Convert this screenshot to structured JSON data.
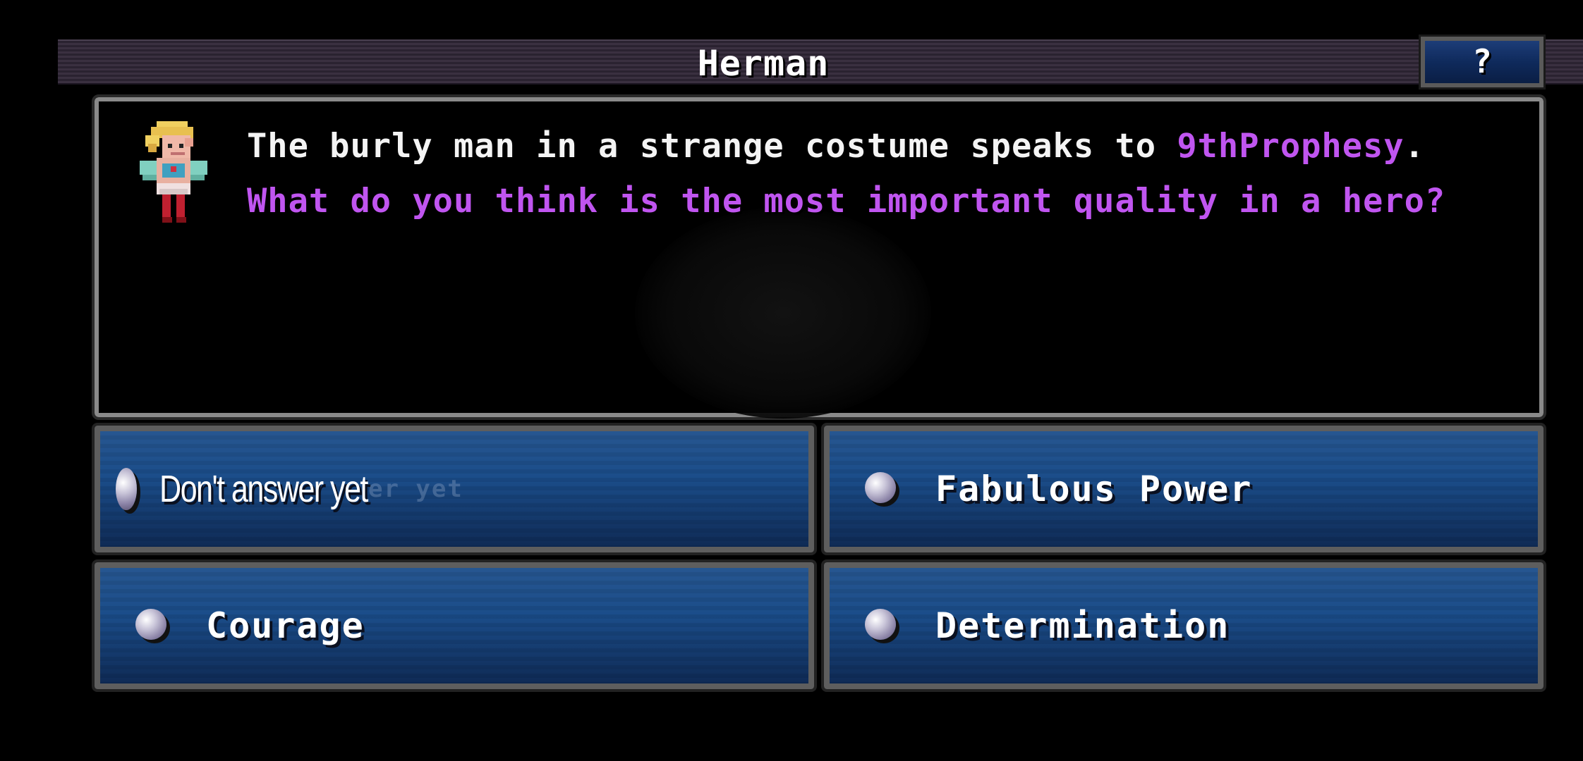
{
  "header": {
    "title": "Herman",
    "help_label": "?"
  },
  "dialog": {
    "line1_prefix": "The burly man in a strange costume speaks to ",
    "player_name": "9thProphesy",
    "line1_suffix": ".",
    "line2": "What do you think is the most important quality in a hero?",
    "portrait_icon": "hero-costume-portrait"
  },
  "choices": [
    {
      "label": "Don't answer yet",
      "ghost": "er yet"
    },
    {
      "label": "Fabulous Power"
    },
    {
      "label": "Courage"
    },
    {
      "label": "Determination"
    }
  ],
  "colors": {
    "highlight": "#c055f0",
    "choice_bg": "#1b4d8a",
    "border": "#8a8a8a"
  }
}
